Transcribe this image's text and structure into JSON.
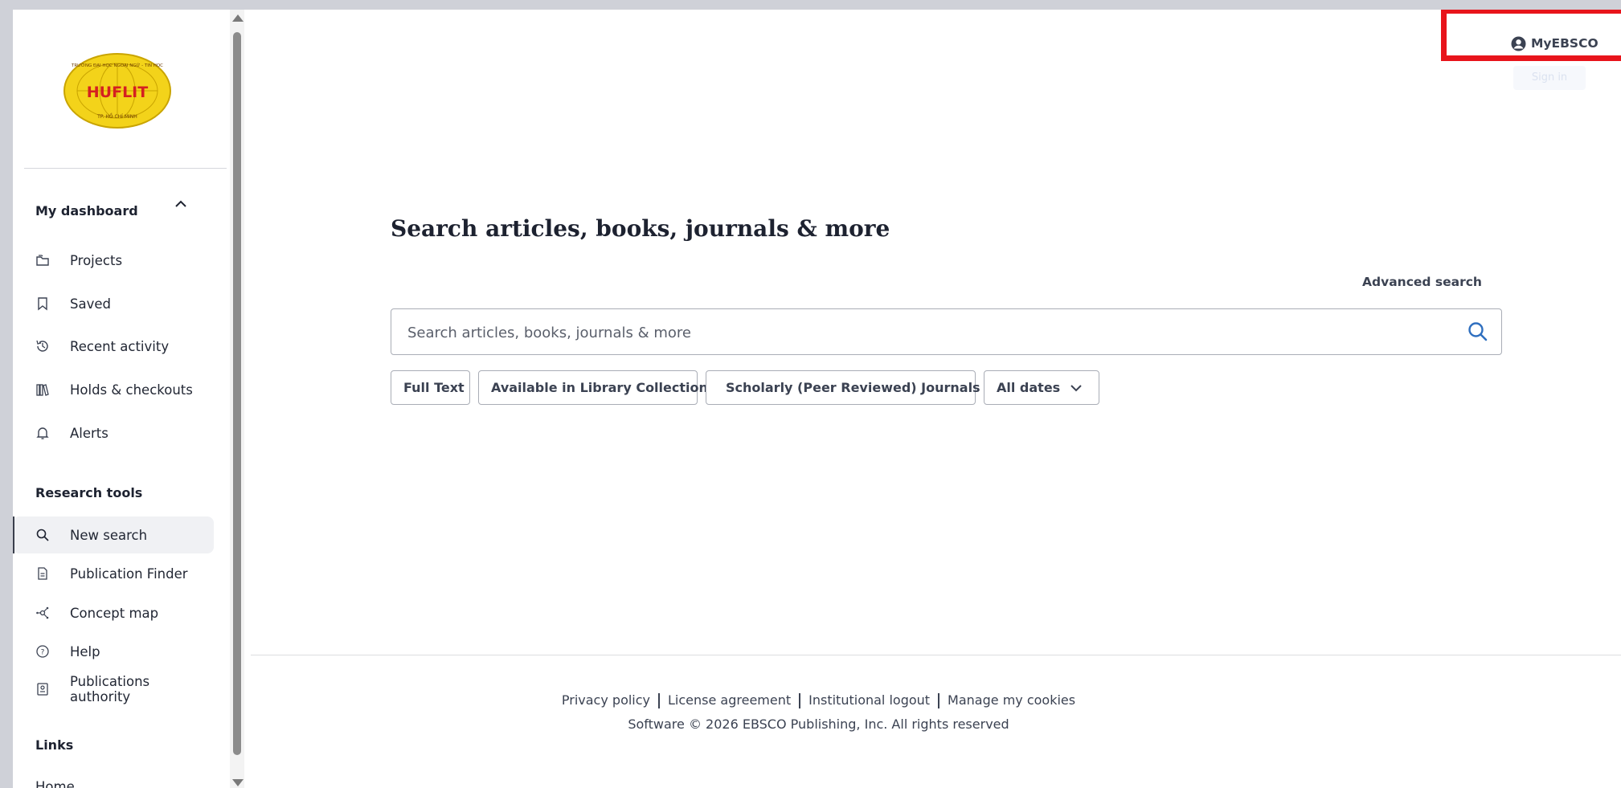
{
  "logo": {
    "name": "HUFLIT",
    "arc_top": "TRƯỜNG ĐẠI HỌC NGOẠI NGỮ - TIN HỌC",
    "arc_bottom": "TP. HỒ CHÍ MINH",
    "colors": {
      "globe": "#f3d31a",
      "text": "#d42020"
    }
  },
  "sidebar": {
    "dashboard_heading": "My dashboard",
    "dashboard_items": [
      {
        "label": "Projects",
        "icon": "folders-icon"
      },
      {
        "label": "Saved",
        "icon": "bookmark-icon"
      },
      {
        "label": "Recent activity",
        "icon": "history-icon"
      },
      {
        "label": "Holds & checkouts",
        "icon": "books-icon"
      },
      {
        "label": "Alerts",
        "icon": "bell-icon"
      }
    ],
    "research_heading": "Research tools",
    "research_items": [
      {
        "label": "New search",
        "icon": "search-icon",
        "active": true
      },
      {
        "label": "Publication Finder",
        "icon": "document-icon"
      },
      {
        "label": "Concept map",
        "icon": "concept-map-icon"
      },
      {
        "label": "Help",
        "icon": "help-icon"
      },
      {
        "label": "Publications authority",
        "icon": "authority-icon"
      }
    ],
    "links_heading": "Links",
    "links": [
      {
        "label": "Home"
      }
    ]
  },
  "header": {
    "myebsco_label": "MyEBSCO",
    "faint_button": "Sign in",
    "highlight_color": "#e8141b"
  },
  "main": {
    "title": "Search articles, books, journals & more",
    "advanced_search": "Advanced search",
    "search_placeholder": "Search articles, books, journals & more",
    "filters": {
      "full_text": "Full Text",
      "library_collection": "Available in Library Collection",
      "peer_reviewed": "Scholarly (Peer Reviewed) Journals",
      "dates": "All dates"
    }
  },
  "footer": {
    "privacy": "Privacy policy",
    "license": "License agreement",
    "logout": "Institutional logout",
    "cookies": "Manage my cookies",
    "copyright": "Software © 2026 EBSCO Publishing, Inc. All rights reserved"
  }
}
